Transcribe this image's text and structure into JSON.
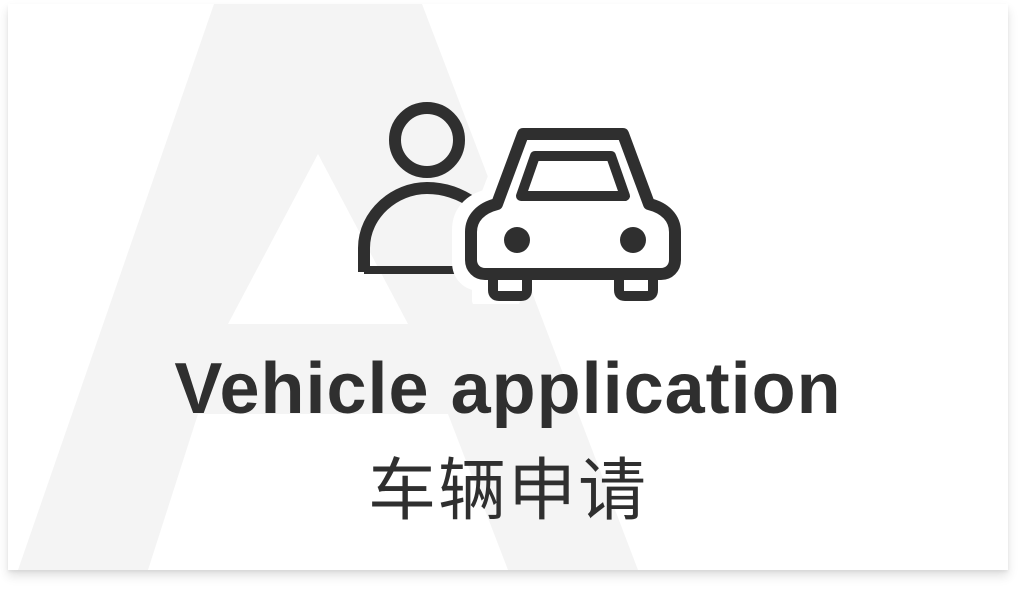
{
  "card": {
    "icon": "user-with-car-icon",
    "watermark_icon": "letter-a-watermark-icon",
    "title_en": "Vehicle application",
    "title_cn": "车辆申请"
  },
  "colors": {
    "text": "#2f2f2f",
    "icon_stroke": "#2f2f2f",
    "watermark": "#f4f4f4",
    "background": "#ffffff"
  }
}
